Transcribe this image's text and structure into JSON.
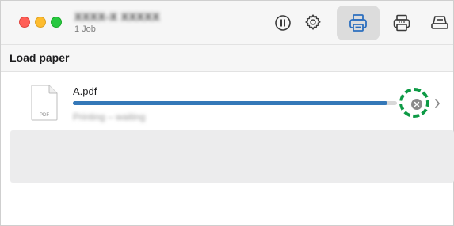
{
  "window": {
    "title": "XXXX-X XXXXX",
    "subtitle": "1 Job"
  },
  "toolbar": {
    "pause_icon": "pause-icon",
    "settings_icon": "gear-icon",
    "printer_icon": "printer-icon",
    "printer_alt_icon": "printer-keypad-icon",
    "tray_icon": "paper-tray-icon"
  },
  "section": {
    "title": "Load paper"
  },
  "job": {
    "file_name": "A.pdf",
    "file_type_label": "PDF",
    "status_text": "Printing – waiting",
    "progress": 0.97
  },
  "colors": {
    "accent": "#3478b8",
    "highlight": "#0d9a45",
    "selected_toolbar_bg": "#dcdcdc"
  }
}
